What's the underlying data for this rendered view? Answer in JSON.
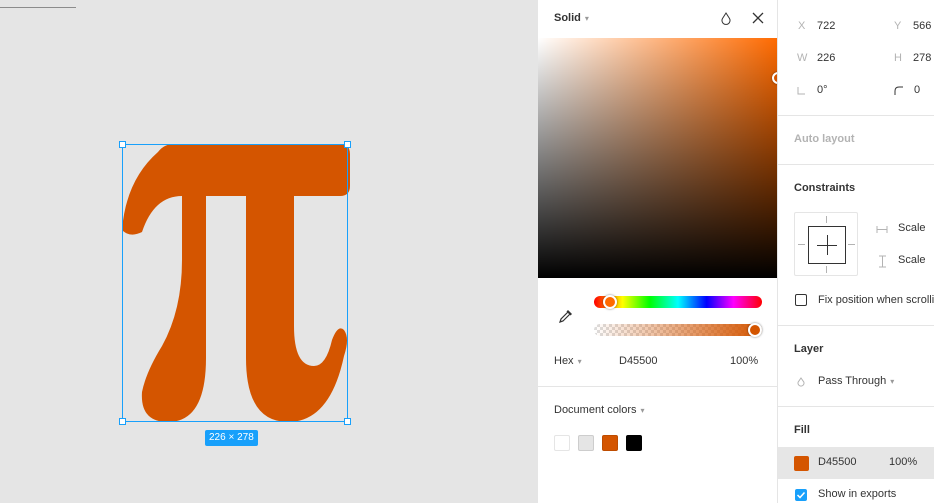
{
  "canvas": {
    "selection_size": "226 × 278",
    "shape_glyph": "π",
    "shape_color": "#D45500"
  },
  "picker": {
    "fill_type": "Solid",
    "format": "Hex",
    "hex": "D45500",
    "opacity": "100%",
    "document_colors_label": "Document colors",
    "swatches": [
      "#FFFFFF",
      "#E5E5E5",
      "#D45500",
      "#000000"
    ]
  },
  "props": {
    "x_label": "X",
    "x_value": "722",
    "y_label": "Y",
    "y_value": "566",
    "w_label": "W",
    "w_value": "226",
    "h_label": "H",
    "h_value": "278",
    "rotation": "0°",
    "radius": "0",
    "auto_layout": "Auto layout",
    "constraints_title": "Constraints",
    "constraint_h": "Scale",
    "constraint_v": "Scale",
    "fix_position": "Fix position when scrolling",
    "layer_title": "Layer",
    "blend_mode": "Pass Through",
    "fill_title": "Fill",
    "fill_hex": "D45500",
    "fill_opacity": "100%",
    "show_in_exports": "Show in exports",
    "accent": "#18A0FB"
  }
}
